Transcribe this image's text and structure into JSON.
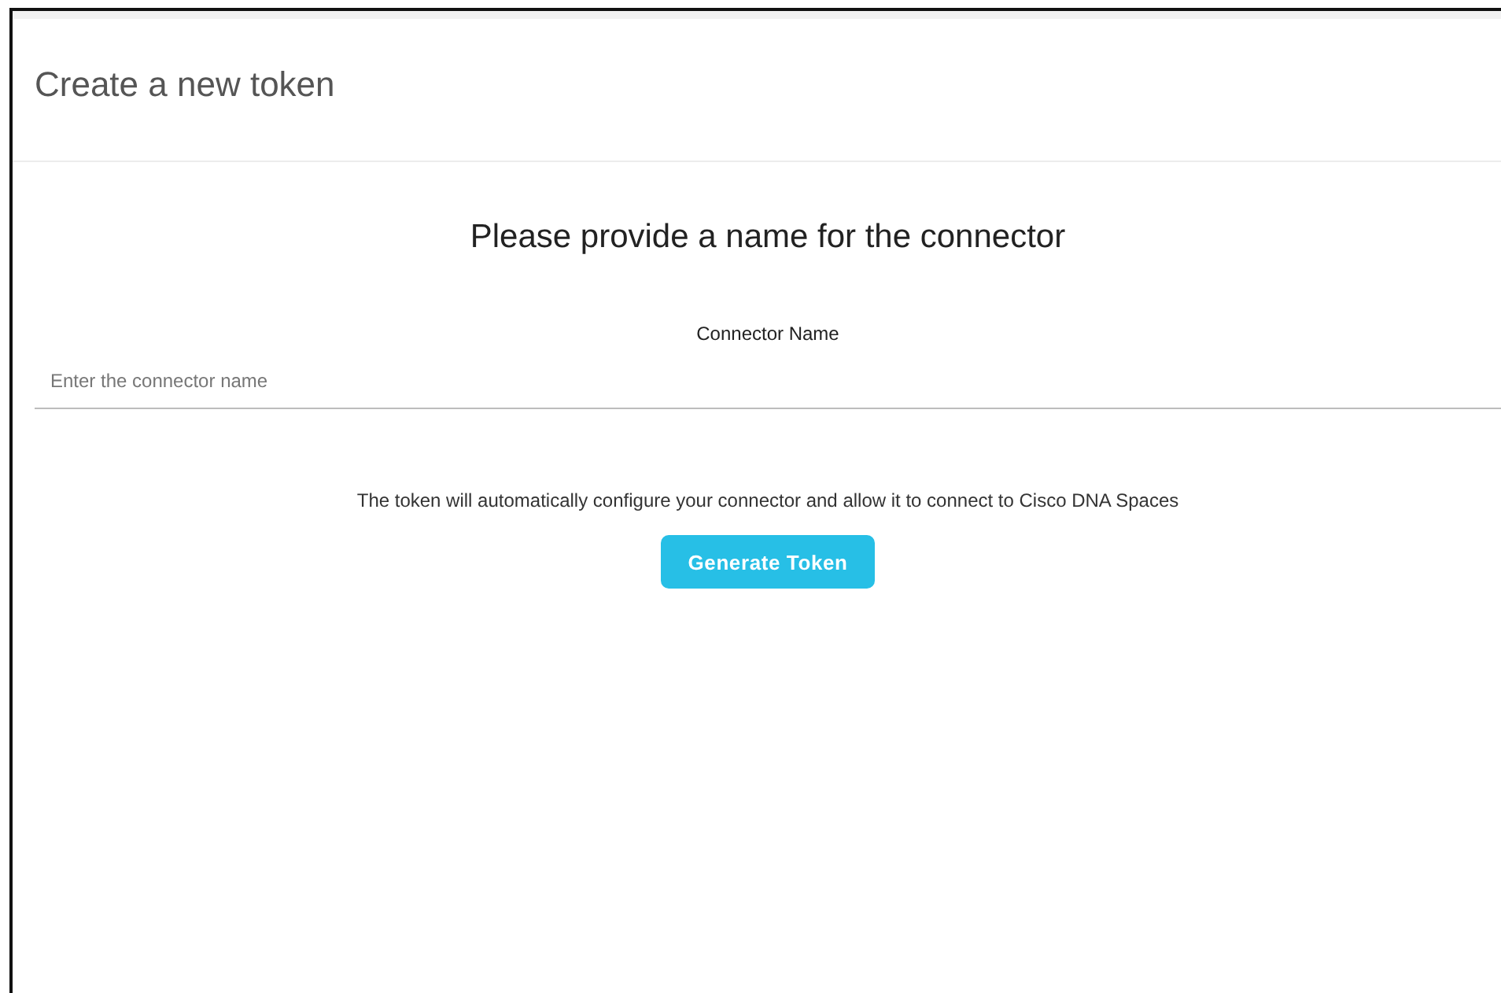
{
  "dialog": {
    "title": "Create a new token"
  },
  "heading": "Please provide a name for the connector",
  "field": {
    "label": "Connector Name",
    "placeholder": "Enter the connector name"
  },
  "note": "The token will automatically configure your connector and allow it to connect to Cisco DNA Spaces",
  "buttons": [
    "Generate Token"
  ]
}
